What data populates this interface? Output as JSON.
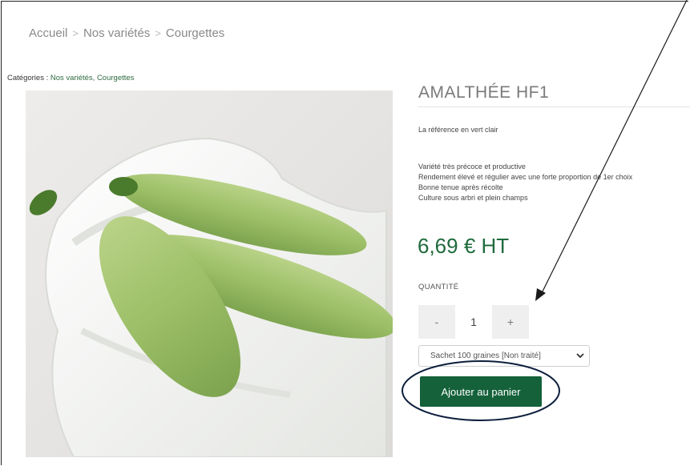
{
  "breadcrumb": [
    "Accueil",
    "Nos variétés",
    "Courgettes"
  ],
  "categories": {
    "label": "Catégories :",
    "links": "Nos variétés, Courgettes"
  },
  "product": {
    "name": "AMALTHÉE HF1",
    "subtitle": "La référence en vert clair",
    "features": [
      "Variété très précoce et productive",
      "Rendement élevé et régulier avec une forte proportion de 1er choix",
      "Bonne tenue après récolte",
      "Culture sous arbri et plein champs"
    ],
    "price": "6,69  € HT"
  },
  "quantity": {
    "label": "QUANTITÉ",
    "minus": "-",
    "value": "1",
    "plus": "+"
  },
  "packaging_select": {
    "selected": "Sachet 100 graines [Non traité]"
  },
  "cart_button": {
    "label": "Ajouter au panier"
  },
  "colors": {
    "brand_green": "#14613a",
    "price_green": "#1f6b3d",
    "annotation": "#0c1e3c"
  }
}
